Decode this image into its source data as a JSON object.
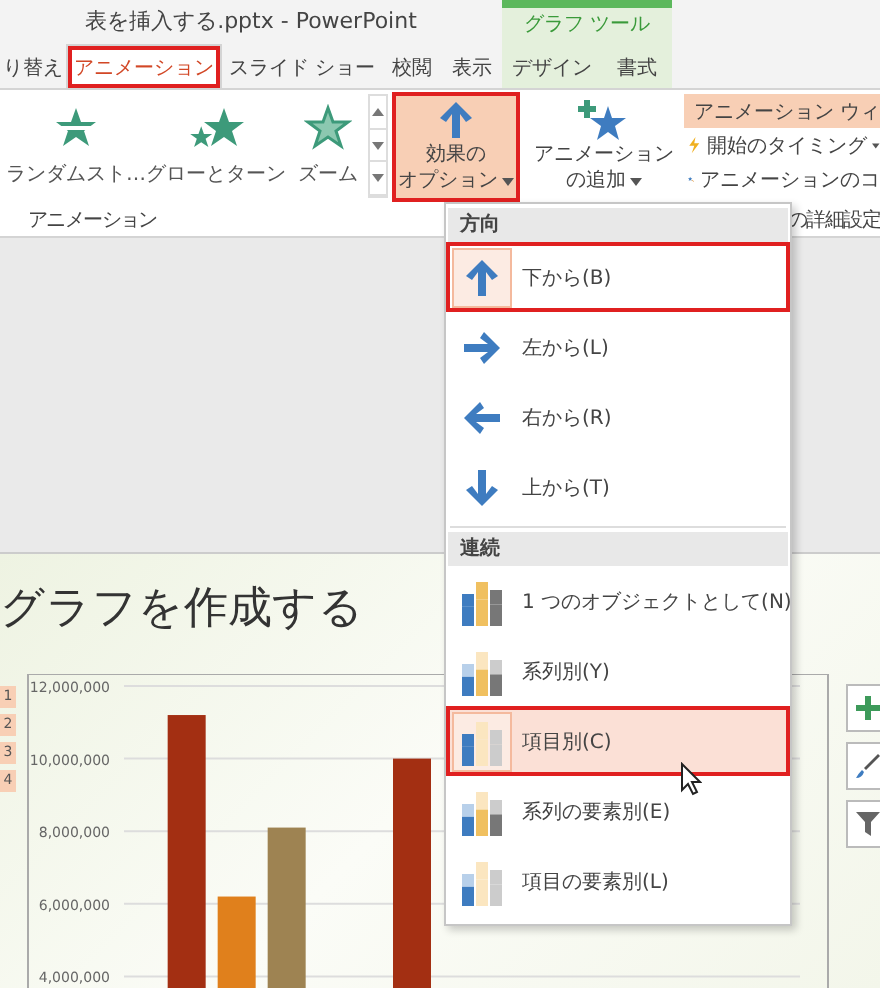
{
  "window": {
    "title": "表を挿入する.pptx - PowerPoint",
    "tool_group": "グラフ ツール"
  },
  "tabs": [
    {
      "label": "り替え",
      "selected": false,
      "contextual": false,
      "callout": false
    },
    {
      "label": "アニメーション",
      "selected": true,
      "contextual": false,
      "callout": true
    },
    {
      "label": "スライド ショー",
      "selected": false,
      "contextual": false,
      "callout": false
    },
    {
      "label": "校閲",
      "selected": false,
      "contextual": false,
      "callout": false
    },
    {
      "label": "表示",
      "selected": false,
      "contextual": false,
      "callout": false
    },
    {
      "label": "デザイン",
      "selected": false,
      "contextual": true,
      "callout": false
    },
    {
      "label": "書式",
      "selected": false,
      "contextual": true,
      "callout": false
    }
  ],
  "ribbon": {
    "gallery": [
      {
        "label": "ランダムスト…",
        "kind": "random"
      },
      {
        "label": "グローとターン",
        "kind": "grow"
      },
      {
        "label": "ズーム",
        "kind": "zoom"
      }
    ],
    "effect_options": {
      "lines": [
        "効果の",
        "オプション"
      ],
      "selected": true,
      "callout": true
    },
    "add_animation": {
      "lines": [
        "アニメーション",
        "の追加"
      ]
    },
    "commands": [
      {
        "label": "アニメーション ウィ",
        "selected": true,
        "kind": "pane"
      },
      {
        "label": "開始のタイミング",
        "selected": false,
        "kind": "trigger"
      },
      {
        "label": "アニメーションのコ",
        "selected": false,
        "kind": "painter"
      }
    ],
    "group_labels": [
      "アニメーション",
      "の詳細設定"
    ]
  },
  "menu": {
    "sections": [
      {
        "header": "方向",
        "items": [
          {
            "label": "下から(B)",
            "kind": "up",
            "selected": true,
            "hovered": false,
            "callout": true
          },
          {
            "label": "左から(L)",
            "kind": "right",
            "selected": false,
            "hovered": false,
            "callout": false
          },
          {
            "label": "右から(R)",
            "kind": "left",
            "selected": false,
            "hovered": false,
            "callout": false
          },
          {
            "label": "上から(T)",
            "kind": "down",
            "selected": false,
            "hovered": false,
            "callout": false
          }
        ]
      },
      {
        "header": "連続",
        "items": [
          {
            "label": "1 つのオブジェクトとして(N)",
            "kind": "whole",
            "selected": false,
            "hovered": false,
            "callout": false
          },
          {
            "label": "系列別(Y)",
            "kind": "series",
            "selected": false,
            "hovered": false,
            "callout": false
          },
          {
            "label": "項目別(C)",
            "kind": "category",
            "selected": true,
            "hovered": true,
            "callout": true
          },
          {
            "label": "系列の要素別(E)",
            "kind": "series",
            "selected": false,
            "hovered": false,
            "callout": false
          },
          {
            "label": "項目の要素別(L)",
            "kind": "category_el",
            "selected": false,
            "hovered": false,
            "callout": false
          }
        ]
      }
    ]
  },
  "slide": {
    "title": "グラフを作成する",
    "order_tags": [
      "1",
      "2",
      "3",
      "4"
    ],
    "chart_data": {
      "type": "bar",
      "grid": true,
      "ylim": [
        4000000,
        12000000
      ],
      "yticks": [
        {
          "value": 12000000,
          "label": "12,000,000"
        },
        {
          "value": 10000000,
          "label": "10,000,000"
        },
        {
          "value": 8000000,
          "label": "8,000,000"
        },
        {
          "value": 6000000,
          "label": "6,000,000"
        },
        {
          "value": 4000000,
          "label": "4,000,000"
        }
      ],
      "series": [
        {
          "color": "#a32f12",
          "values": [
            11200000,
            10000000,
            null
          ]
        },
        {
          "color": "#e0801c",
          "values": [
            6200000,
            null,
            null
          ]
        },
        {
          "color": "#9e8352",
          "values": [
            8100000,
            null,
            null
          ]
        }
      ]
    }
  }
}
